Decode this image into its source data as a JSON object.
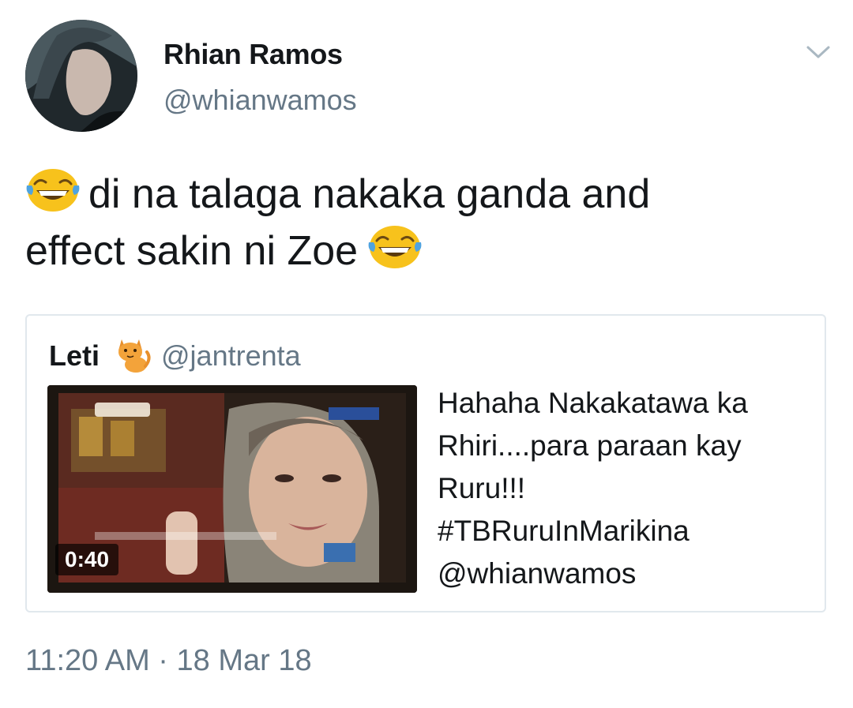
{
  "author": {
    "display_name": "Rhian Ramos",
    "handle": "@whianwamos",
    "avatar_icon": "profile-photo"
  },
  "menu": {
    "icon": "chevron-down-icon"
  },
  "tweet": {
    "emoji": "face-with-tears-of-joy",
    "line1": "di na talaga nakaka ganda and",
    "line2": "effect sakin ni Zoe"
  },
  "quoted_tweet": {
    "name": "Leti",
    "name_emoji": "cat-icon",
    "handle": "@jantrenta",
    "video": {
      "duration": "0:40"
    },
    "text_lines": [
      "Hahaha Nakakatawa ka",
      "Rhiri....para paraan kay",
      "Ruru!!!",
      "#TBRuruInMarikina",
      "@whianwamos"
    ]
  },
  "timestamp": "11:20 AM · 18 Mar 18",
  "colors": {
    "text": "#14171a",
    "secondary": "#657786",
    "border": "#e1e8ed",
    "emoji_yellow": "#f7c21c"
  }
}
